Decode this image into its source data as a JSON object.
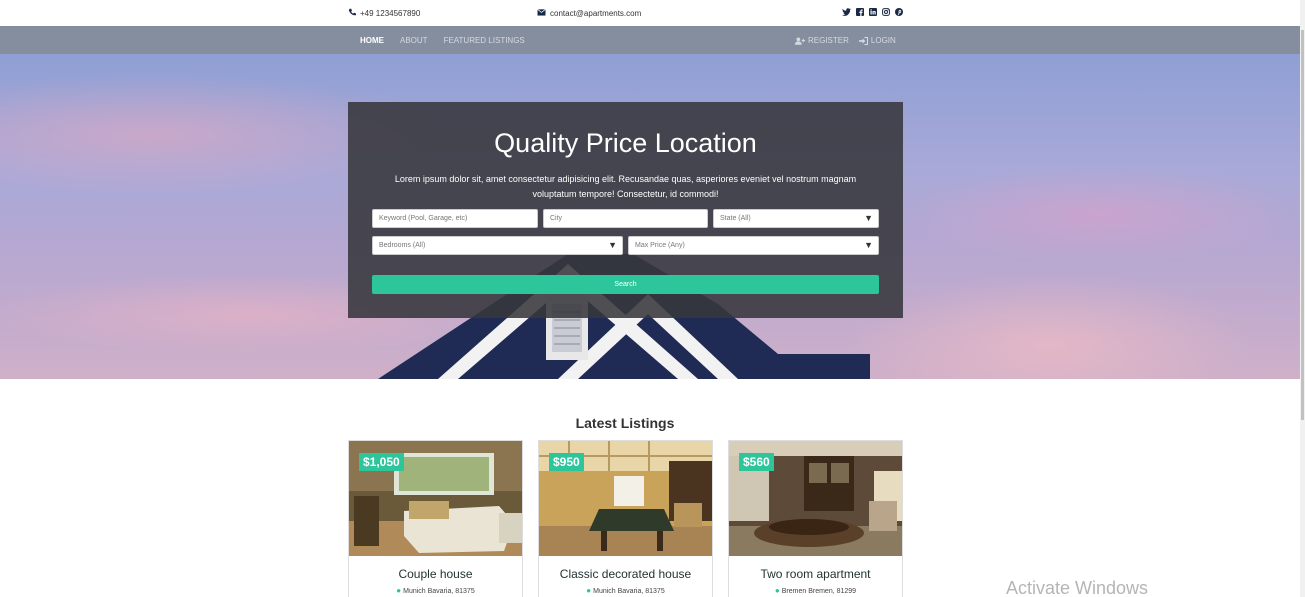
{
  "topbar": {
    "phone": "+49 1234567890",
    "email": "contact@apartments.com",
    "social_icons": [
      "twitter-icon",
      "facebook-icon",
      "linkedin-icon",
      "instagram-icon",
      "pinterest-icon"
    ]
  },
  "nav": {
    "links": [
      "HOME",
      "ABOUT",
      "FEATURED LISTINGS"
    ],
    "register": "REGISTER",
    "login": "LOGIN"
  },
  "hero": {
    "title": "Quality Price Location",
    "description": "Lorem ipsum dolor sit, amet consectetur adipisicing elit. Recusandae quas, asperiores eveniet vel nostrum magnam voluptatum tempore! Consectetur, id commodi!",
    "keyword_placeholder": "Keyword (Pool, Garage, etc)",
    "city_placeholder": "City",
    "state_select": "State (All)",
    "bedrooms_select": "Bedrooms (All)",
    "price_select": "Max Price (Any)",
    "search_label": "Search"
  },
  "listings": {
    "title": "Latest Listings",
    "items": [
      {
        "price": "$1,050",
        "title": "Couple house",
        "location": "Munich Bavaria, 81375"
      },
      {
        "price": "$950",
        "title": "Classic decorated house",
        "location": "Munich Bavaria, 81375"
      },
      {
        "price": "$560",
        "title": "Two room apartment",
        "location": "Bremen Bremen, 81299"
      }
    ]
  },
  "watermark": "Activate Windows",
  "colors": {
    "accent": "#2dc69b",
    "nav": "#858e9f",
    "search_box": "#37373c"
  }
}
